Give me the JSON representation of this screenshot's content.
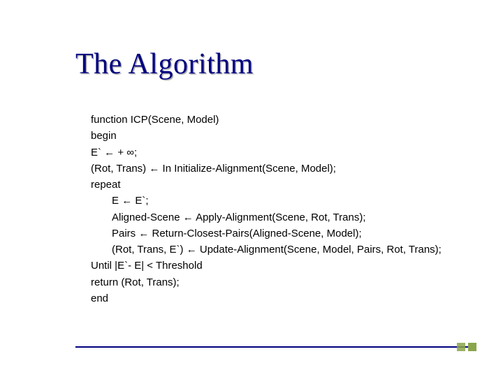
{
  "title": "The Algorithm",
  "code": {
    "l1": "function ICP(Scene, Model)",
    "l2": "begin",
    "l3_pre": "E` ",
    "l3_post": " + ∞;",
    "l4_pre": "(Rot, Trans) ",
    "l4_post": " In Initialize-Alignment(Scene, Model);",
    "l5": "repeat",
    "l6_pre": "E ",
    "l6_post": " E`;",
    "l7_pre": "Aligned-Scene ",
    "l7_post": " Apply-Alignment(Scene, Rot, Trans);",
    "l8_pre": "Pairs ",
    "l8_post": " Return-Closest-Pairs(Aligned-Scene, Model);",
    "l9_pre": "(Rot, Trans, E`) ",
    "l9_post": " Update-Alignment(Scene, Model, Pairs, Rot, Trans);",
    "l10": "Until |E`- E|  < Threshold",
    "l11": "return (Rot, Trans);",
    "l12": "end"
  },
  "arrow": "←"
}
